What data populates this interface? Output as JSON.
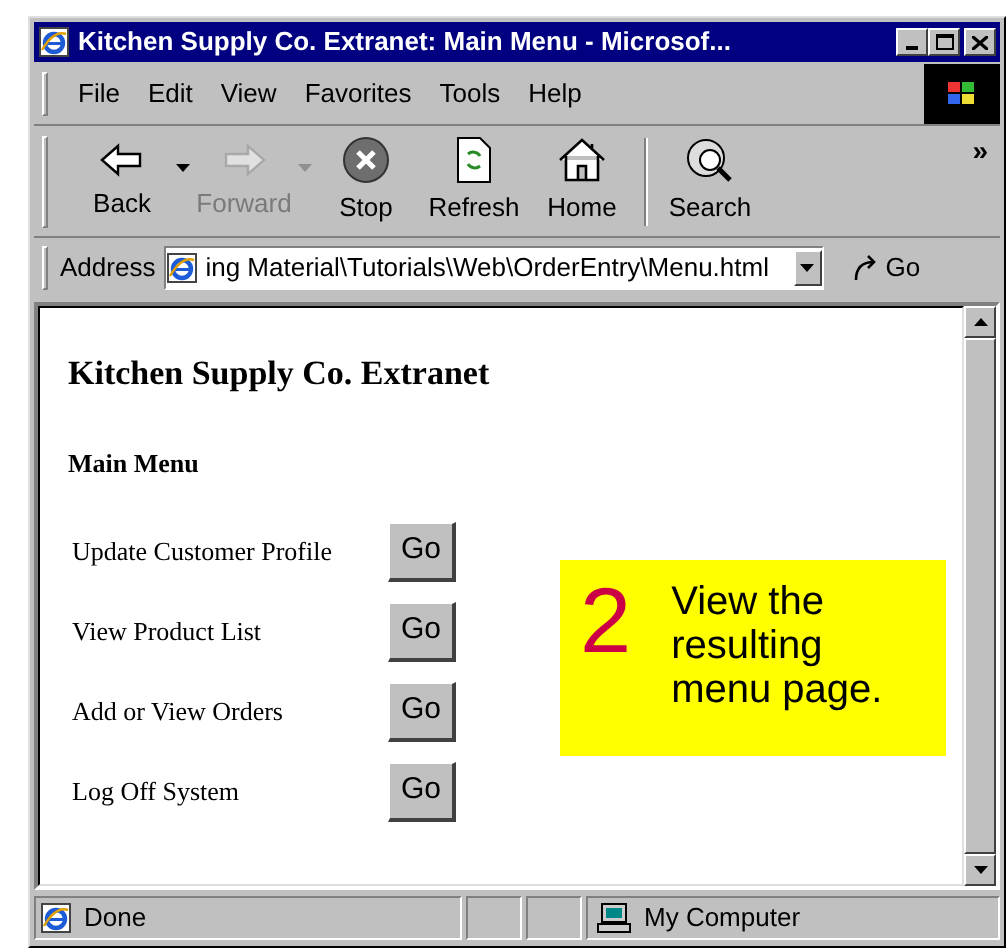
{
  "window": {
    "title": "Kitchen Supply Co. Extranet: Main Menu - Microsof..."
  },
  "menu": [
    "File",
    "Edit",
    "View",
    "Favorites",
    "Tools",
    "Help"
  ],
  "toolbar": [
    {
      "kind": "back",
      "label": "Back",
      "disabled": false,
      "dropdown": true
    },
    {
      "kind": "forward",
      "label": "Forward",
      "disabled": true,
      "dropdown": true
    },
    {
      "kind": "stop",
      "label": "Stop",
      "disabled": false,
      "dropdown": false
    },
    {
      "kind": "refresh",
      "label": "Refresh",
      "disabled": false,
      "dropdown": false
    },
    {
      "kind": "home",
      "label": "Home",
      "disabled": false,
      "dropdown": false
    },
    {
      "kind": "search",
      "label": "Search",
      "disabled": false,
      "dropdown": false
    }
  ],
  "toolbar_more": "»",
  "address": {
    "label": "Address",
    "value": "ing Material\\Tutorials\\Web\\OrderEntry\\Menu.html",
    "go": "Go"
  },
  "page": {
    "heading": "Kitchen Supply Co. Extranet",
    "subheading": "Main Menu",
    "items": [
      {
        "label": "Update Customer Profile",
        "button": "Go"
      },
      {
        "label": "View Product List",
        "button": "Go"
      },
      {
        "label": "Add or View Orders",
        "button": "Go"
      },
      {
        "label": "Log Off System",
        "button": "Go"
      }
    ]
  },
  "callout": {
    "number": "2",
    "text": "View the resulting menu page."
  },
  "status_bar": {
    "status": "Done",
    "zone": "My Computer"
  }
}
